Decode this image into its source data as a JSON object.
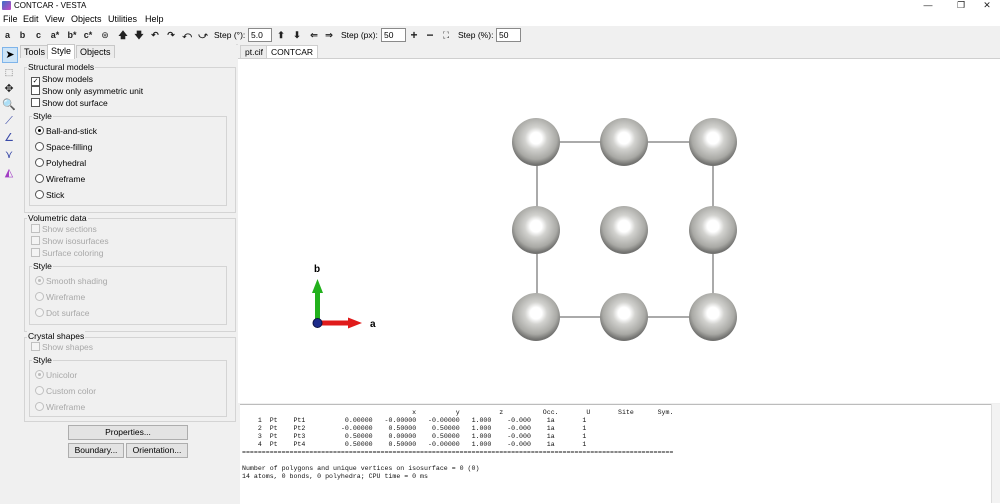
{
  "window": {
    "title": "CONTCAR - VESTA",
    "minimize": "—",
    "maximize": "❐",
    "close": "✕"
  },
  "menu": [
    "File",
    "Edit",
    "View",
    "Objects",
    "Utilities",
    "Help"
  ],
  "toolbar": {
    "axis_buttons": [
      "a",
      "b",
      "c",
      "a*",
      "b*",
      "c*"
    ],
    "step_deg_label": "Step (°):",
    "step_deg_value": "5.0",
    "step_px_label": "Step (px):",
    "step_px_value": "50",
    "step_pct_label": "Step (%):",
    "step_pct_value": "50"
  },
  "panel": {
    "tabs": [
      "Tools",
      "Style",
      "Objects"
    ],
    "active_tab": "Style",
    "structural_models": {
      "title": "Structural models",
      "show_models": "Show models",
      "show_asym": "Show only asymmetric unit",
      "show_dot": "Show dot surface",
      "style_title": "Style",
      "styles": [
        "Ball-and-stick",
        "Space-filling",
        "Polyhedral",
        "Wireframe",
        "Stick"
      ]
    },
    "volumetric": {
      "title": "Volumetric data",
      "show_sections": "Show sections",
      "show_isosurfaces": "Show isosurfaces",
      "surface_coloring": "Surface coloring",
      "style_title": "Style",
      "styles": [
        "Smooth shading",
        "Wireframe",
        "Dot surface"
      ]
    },
    "crystal_shapes": {
      "title": "Crystal shapes",
      "show_shapes": "Show shapes",
      "style_title": "Style",
      "styles": [
        "Unicolor",
        "Custom color",
        "Wireframe"
      ]
    },
    "buttons": {
      "properties": "Properties...",
      "boundary": "Boundary...",
      "orientation": "Orientation..."
    }
  },
  "doc_tabs": [
    "pt.cif",
    "CONTCAR"
  ],
  "active_doc": "CONTCAR",
  "viewer": {
    "axis_a": "a",
    "axis_b": "b",
    "colors": {
      "atom": "#a9a9a5",
      "axis_a": "#e01b1b",
      "axis_b": "#22b11c"
    }
  },
  "output": {
    "header": {
      "x": "x",
      "y": "y",
      "z": "z",
      "occ": "Occ.",
      "u": "U",
      "site": "Site",
      "sym": "Sym."
    },
    "rows": [
      {
        "n": "1",
        "el": "Pt",
        "label": "Pt1",
        "x": "0.00000",
        "y": "-0.00000",
        "z": "-0.00000",
        "occ": "1.000",
        "u": "-0.000",
        "site": "1a",
        "sym": "1"
      },
      {
        "n": "2",
        "el": "Pt",
        "label": "Pt2",
        "x": "-0.00000",
        "y": "0.50000",
        "z": "0.50000",
        "occ": "1.000",
        "u": "-0.000",
        "site": "1a",
        "sym": "1"
      },
      {
        "n": "3",
        "el": "Pt",
        "label": "Pt3",
        "x": "0.50000",
        "y": "0.00000",
        "z": "0.50000",
        "occ": "1.000",
        "u": "-0.000",
        "site": "1a",
        "sym": "1"
      },
      {
        "n": "4",
        "el": "Pt",
        "label": "Pt4",
        "x": "0.50000",
        "y": "0.50000",
        "z": "-0.00000",
        "occ": "1.000",
        "u": "-0.000",
        "site": "1a",
        "sym": "1"
      }
    ],
    "separator": "=============================================================================================================",
    "line1": "Number of polygons and unique vertices on isosurface = 0 (0)",
    "line2": "14 atoms, 0 bonds, 0 polyhedra; CPU time = 0 ms"
  }
}
